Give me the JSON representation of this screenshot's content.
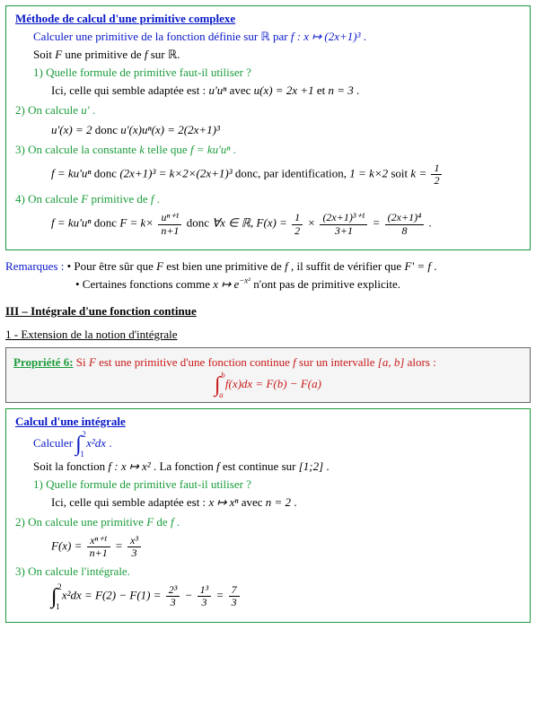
{
  "box1": {
    "title": "Méthode de calcul d'une primitive complexe",
    "l1a": "Calculer une primitive de la fonction définie sur ",
    "l1b": "ℝ",
    "l1c": "  par ",
    "l1d": "f : x ↦ (2x+1)³",
    "l1e": " .",
    "l2a": "Soit ",
    "l2b": "F",
    "l2c": " une primitive de ",
    "l2d": "f",
    "l2e": " sur ",
    "l2f": "ℝ.",
    "q1": "1) Quelle formule de primitive faut-il utiliser ?",
    "a1a": "Ici, celle qui semble adaptée est : ",
    "a1b": "u'uⁿ",
    "a1c": "  avec ",
    "a1d": "u(x) = 2x +1",
    "a1e": "  et  ",
    "a1f": "n = 3",
    "a1g": " .",
    "q2": "2) On calcule ",
    "q2b": "u'",
    "q2c": " .",
    "a2a": "u'(x) = 2",
    "a2b": "  donc  ",
    "a2c": "u'(x)uⁿ(x) = 2(2x+1)³",
    "q3a": "3) On calcule la constante ",
    "q3b": "k",
    "q3c": " telle que ",
    "q3d": "f = ku'uⁿ",
    "q3e": " .",
    "a3a": "f = ku'uⁿ",
    "a3b": "  donc ",
    "a3c": "(2x+1)³ = k×2×(2x+1)³",
    "a3d": "  donc, par identification,  ",
    "a3e": "1 = k×2",
    "a3f": "  soit  ",
    "a3g": "k =",
    "frac12n": "1",
    "frac12d": "2",
    "q4a": "4) On calcule ",
    "q4b": "F",
    "q4c": "  primitive de ",
    "q4d": "f",
    "q4e": " .",
    "a4a": "f = ku'uⁿ",
    "a4b": "  donc  ",
    "a4c": "F = k×",
    "a4fn": "uⁿ⁺¹",
    "a4fd": "n+1",
    "a4e": "  donc  ",
    "a4f": "∀x ∈ ℝ, F(x) =",
    "a4g1": "1",
    "a4g2": "2",
    "a4h": " ×",
    "a4in": "(2x+1)³⁺¹",
    "a4id": "3+1",
    "a4j": " = ",
    "a4kn": "(2x+1)⁴",
    "a4kd": "8",
    "a4l": " ."
  },
  "remarks": {
    "label": "Remarques :",
    "r1a": " • Pour être sûr que ",
    "r1b": "F",
    "r1c": "  est bien une primitive de ",
    "r1d": "f",
    "r1e": " , il suffit de vérifier que ",
    "r1f": "F' = f",
    "r1g": " .",
    "r2a": "• Certaines fonctions comme ",
    "r2b": "x ↦ e",
    "r2bsup": "−x²",
    "r2c": " n'ont pas de primitive explicite."
  },
  "sec3": "III – Intégrale d'une fonction continue",
  "sub1": "1 - Extension de la notion d'intégrale",
  "prop6": {
    "label": "Propriété 6:",
    "t1": " Si ",
    "t2": "F",
    "t3": "  est une primitive d'une fonction continue ",
    "t4": "f",
    "t5": "  sur un intervalle ",
    "t6": "[a, b]",
    "t7": "  alors :",
    "int_a": "a",
    "int_b": "b",
    "expr": "f(x)dx = F(b) − F(a)"
  },
  "box2": {
    "title": "Calcul d'une intégrale",
    "l1a": "Calculer ",
    "int_a": "1",
    "int_b": "2",
    "l1b": "x²dx",
    "l1c": " .",
    "l2a": "Soit la fonction ",
    "l2b": "f : x ↦ x²",
    "l2c": " . La fonction ",
    "l2d": "f",
    "l2e": "  est continue sur ",
    "l2f": "[1;2]",
    "l2g": " .",
    "q1": "1) Quelle formule de primitive faut-il utiliser ?",
    "a1a": "Ici, celle qui semble adaptée est : ",
    "a1b": "x ↦ xⁿ",
    "a1c": "  avec ",
    "a1d": "n = 2",
    "a1e": " .",
    "q2a": "2) On calcule une primitive ",
    "q2b": "F",
    "q2c": "  de ",
    "q2d": "f",
    "q2e": " .",
    "a2a": "F(x) =",
    "a2fn": "xⁿ⁺¹",
    "a2fd": "n+1",
    "a2b": " = ",
    "a2gn": "x³",
    "a2gd": "3",
    "q3": "3) On calcule l'intégrale.",
    "a3a": "x²dx = F(2) − F(1) =",
    "a3fn": "2³",
    "a3fd": "3",
    "a3b": " − ",
    "a3gn": "1³",
    "a3gd": "3",
    "a3c": " = ",
    "a3hn": "7",
    "a3hd": "3"
  }
}
